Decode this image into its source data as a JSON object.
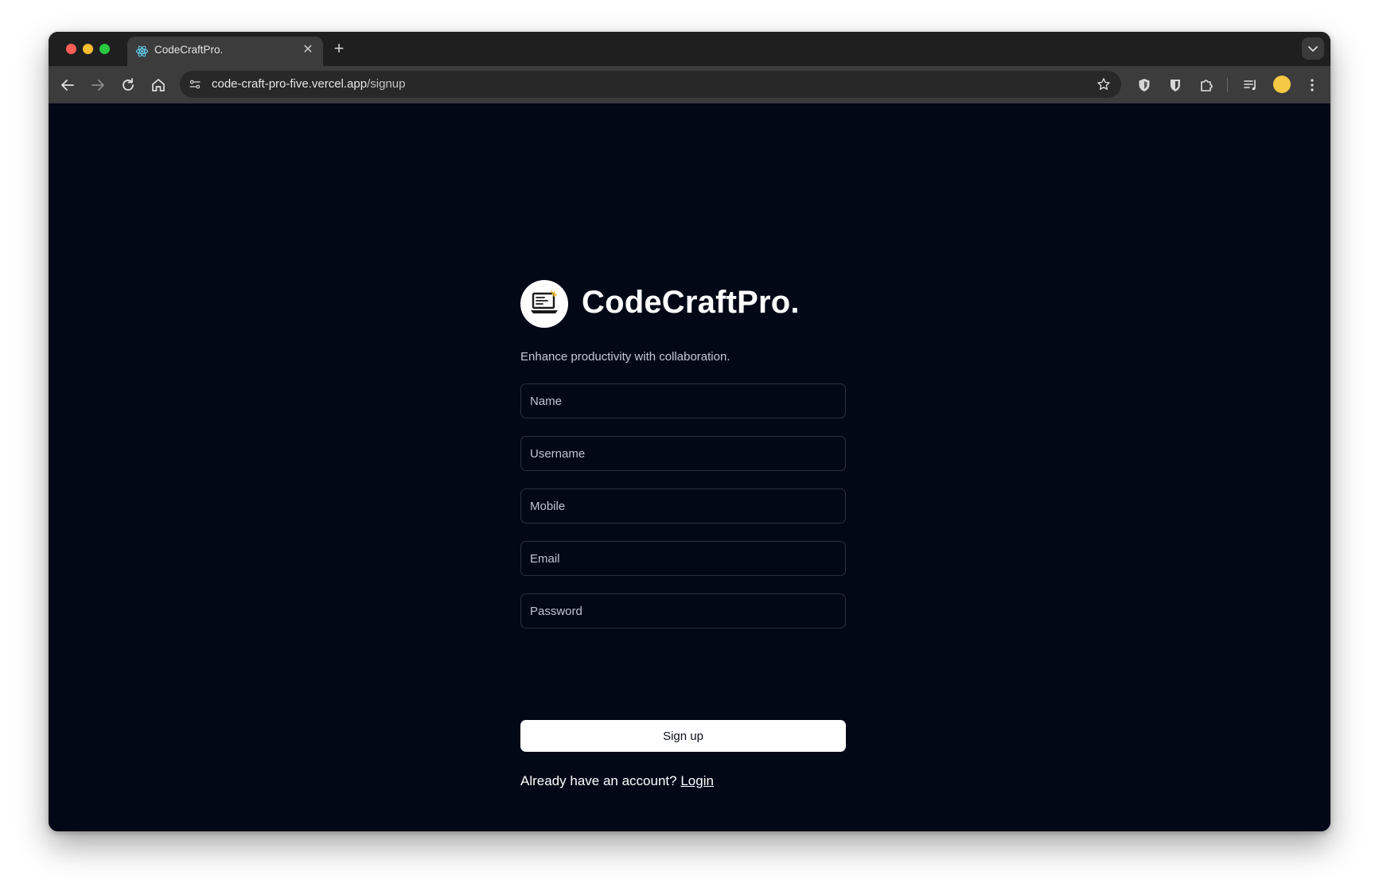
{
  "browser": {
    "tab_title": "CodeCraftPro.",
    "url_host": "code-craft-pro-five.vercel.app",
    "url_path": "/signup"
  },
  "brand": {
    "name": "CodeCraftPro.",
    "tagline": "Enhance productivity with collaboration."
  },
  "form": {
    "name_placeholder": "Name",
    "username_placeholder": "Username",
    "mobile_placeholder": "Mobile",
    "email_placeholder": "Email",
    "password_placeholder": "Password",
    "submit_label": "Sign up"
  },
  "footer": {
    "prompt": "Already have an account?",
    "login_label": "Login"
  },
  "colors": {
    "page_background": "#030817",
    "button_background": "#ffffff",
    "avatar": "#f6c945"
  },
  "icons": {
    "tab_favicon": "react-atom-icon",
    "logo": "laptop-code-icon"
  }
}
